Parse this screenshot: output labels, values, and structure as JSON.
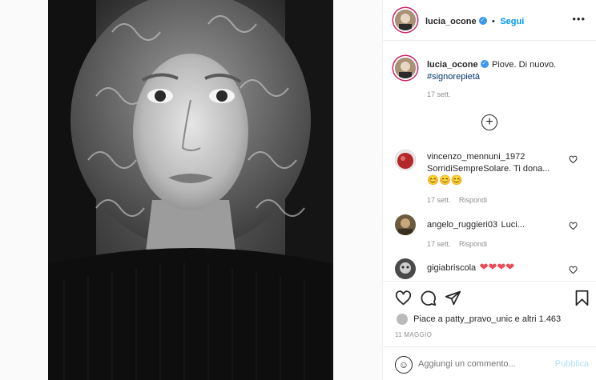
{
  "header": {
    "username": "lucia_ocone",
    "dot": "•",
    "follow_label": "Segui",
    "more_icon": "more-horizontal-icon"
  },
  "caption": {
    "username": "lucia_ocone",
    "text": "Piove. Di nuovo.",
    "hashtag": "#signorepietà",
    "time": "17 sett."
  },
  "load_more_icon": "plus-circle-icon",
  "comments": [
    {
      "username": "vincenzo_mennuni_1972",
      "text": "SorridiSempreSolare. Ti dona...",
      "emoji": "😊😊😊",
      "time": "17 sett.",
      "reply": "Rispondi"
    },
    {
      "username": "angelo_ruggieri03",
      "text": "Luci...",
      "time": "17 sett.",
      "reply": "Rispondi"
    },
    {
      "username": "gigiabriscola",
      "text": "❤❤❤❤"
    }
  ],
  "actions": {
    "likes_text": "Piace a",
    "likes_user": "patty_pravo_unic",
    "likes_tail": "e altri",
    "likes_count": "1.463",
    "date": "11 MAGGIO"
  },
  "comment_box": {
    "placeholder": "Aggiungi un commento...",
    "publish_label": "Pubblica"
  },
  "colors": {
    "accent": "#0095f6",
    "heart_red": "#ed4956",
    "story_ring": "#c7256a"
  }
}
